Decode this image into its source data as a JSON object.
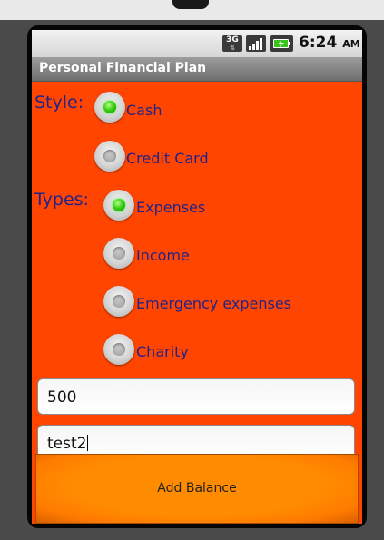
{
  "status_bar": {
    "network_badge": "3G",
    "time": "6:24",
    "ampm": "AM",
    "icons": [
      "network-3g-icon",
      "signal-strength-icon",
      "battery-charging-icon"
    ]
  },
  "app": {
    "title": "Personal Financial Plan"
  },
  "style_group": {
    "label": "Style:",
    "options": [
      {
        "label": "Cash",
        "checked": true
      },
      {
        "label": "Credit Card",
        "checked": false
      }
    ]
  },
  "types_group": {
    "label": "Types:",
    "options": [
      {
        "label": "Expenses",
        "checked": true
      },
      {
        "label": "Income",
        "checked": false
      },
      {
        "label": "Emergency expenses",
        "checked": false
      },
      {
        "label": "Charity",
        "checked": false
      }
    ]
  },
  "inputs": {
    "amount": {
      "value": "500"
    },
    "description": {
      "value": "test2"
    }
  },
  "actions": {
    "add_balance_label": "Add Balance"
  },
  "colors": {
    "screen_background": "#ff4500",
    "label_text": "#22238a",
    "button_background": "#ff8c00",
    "radio_checked": "#3ccf12"
  }
}
